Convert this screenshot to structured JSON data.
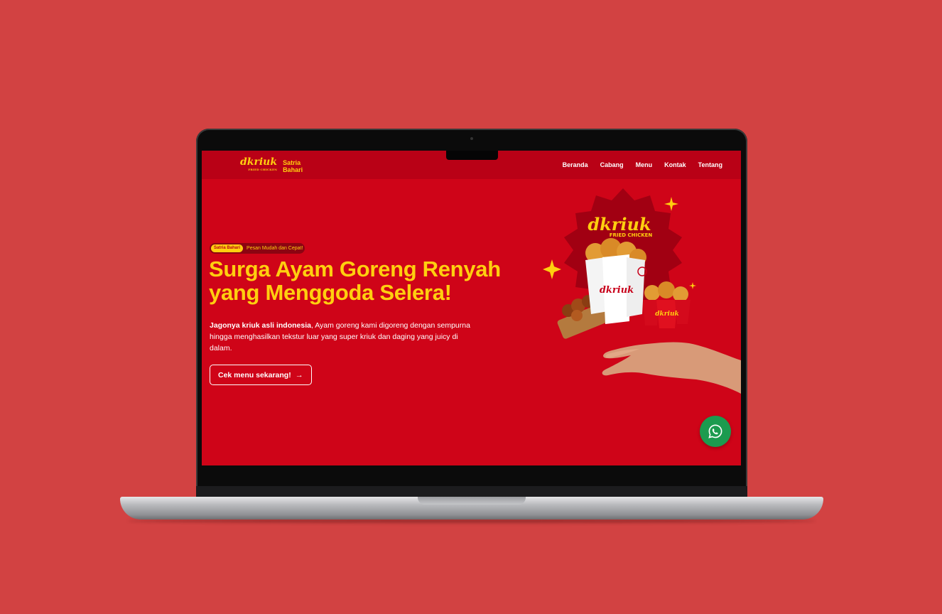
{
  "brand": {
    "logo_text": "dkriuk",
    "logo_subtext": "FRIED CHICKEN",
    "name": "Satria Bahari"
  },
  "nav": {
    "items": [
      {
        "label": "Beranda"
      },
      {
        "label": "Cabang"
      },
      {
        "label": "Menu"
      },
      {
        "label": "Kontak"
      },
      {
        "label": "Tentang"
      }
    ]
  },
  "hero": {
    "badge": "Satria Bahari",
    "tagline": "Pesan Mudah dan Cepat!",
    "headline": "Surga Ayam Goreng Renyah yang Menggoda Selera!",
    "desc_bold": "Jagonya kriuk asli indonesia",
    "desc_rest": ", Ayam goreng kami digoreng dengan sempurna hingga menghasilkan tekstur luar yang super kriuk dan daging yang juicy di dalam.",
    "cta_label": "Cek menu sekarang!",
    "image_logo": "dkriuk",
    "image_logo_sub": "FRIED CHICKEN",
    "cup_logo": "dkriuk"
  },
  "colors": {
    "page_background": "#d24242",
    "site_red": "#cf0418",
    "navbar_red": "#b90116",
    "accent_yellow": "#ffcf0f",
    "whatsapp_green": "#1c9b4f"
  },
  "icons": {
    "cta": "arrow-right-icon",
    "floating": "whatsapp-icon"
  }
}
